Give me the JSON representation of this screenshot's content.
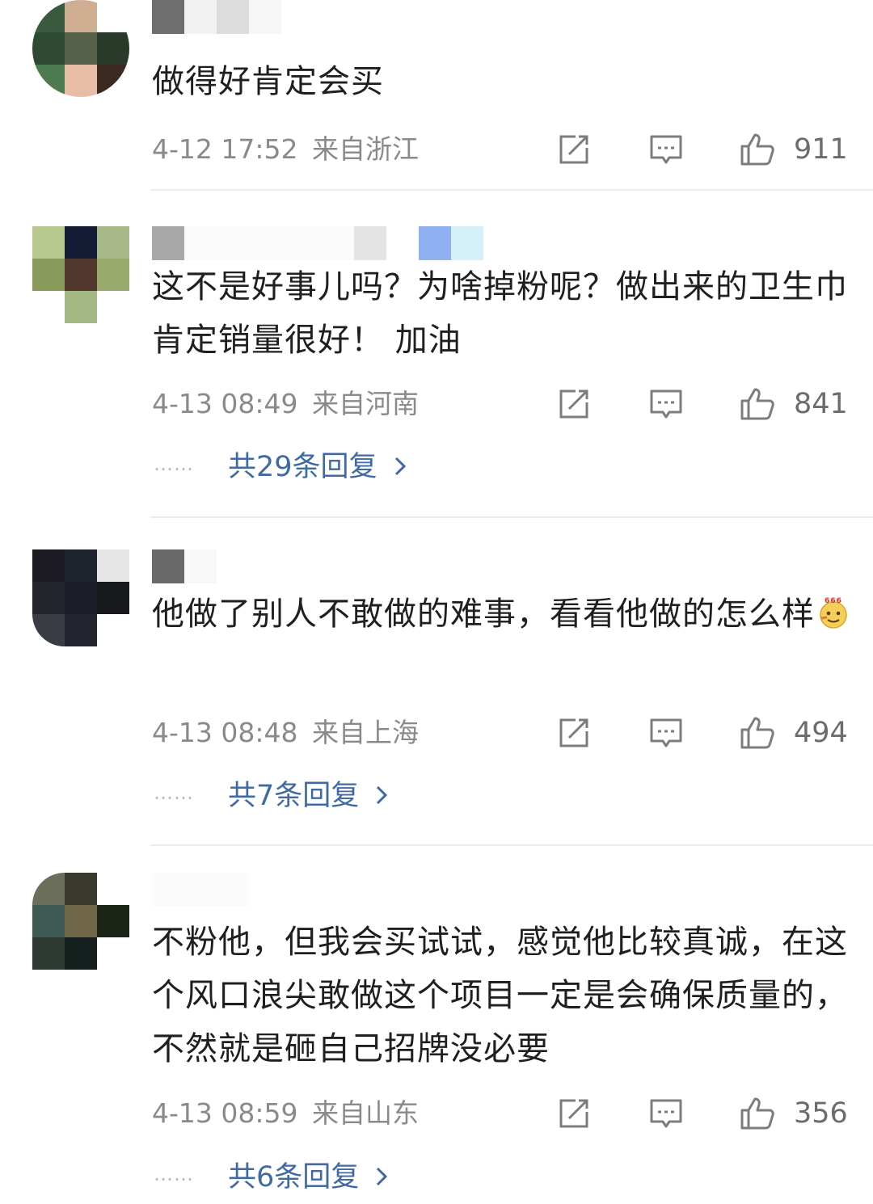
{
  "comments": [
    {
      "text": "做得好肯定会买",
      "time": "4-12 17:52",
      "location": "来自浙江",
      "likes": "911",
      "icons": [
        "share-icon",
        "reply-icon",
        "thumbs-up-icon"
      ]
    },
    {
      "text": "这不是好事儿吗？为啥掉粉呢？做出来的卫生巾肯定销量很好！ 加油",
      "time": "4-13 08:49",
      "location": "来自河南",
      "likes": "841",
      "replies_dots": "……",
      "replies": "共29条回复",
      "icons": [
        "share-icon",
        "reply-icon",
        "thumbs-up-icon"
      ]
    },
    {
      "text": "他做了别人不敢做的难事，看看他做的怎么样",
      "emoji": "666-emoji-icon",
      "time": "4-13 08:48",
      "location": "来自上海",
      "likes": "494",
      "replies_dots": "……",
      "replies": "共7条回复",
      "icons": [
        "share-icon",
        "reply-icon",
        "thumbs-up-icon"
      ]
    },
    {
      "text": "不粉他，但我会买试试，感觉他比较真诚，在这个风口浪尖敢做这个项目一定是会确保质量的，不然就是砸自己招牌没必要",
      "time": "4-13 08:59",
      "location": "来自山东",
      "likes": "356",
      "replies_dots": "……",
      "replies": "共6条回复",
      "icons": [
        "share-icon",
        "reply-icon",
        "thumbs-up-icon"
      ]
    }
  ],
  "colors": {
    "meta_text": "#8a8a8a",
    "reply_link": "#3f6aa4",
    "divider": "#ececec",
    "body_text": "#1f1f1f"
  }
}
